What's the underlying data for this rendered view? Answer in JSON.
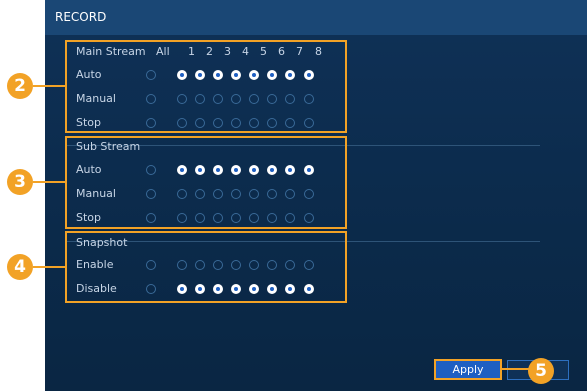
{
  "window": {
    "title": "RECORD"
  },
  "main_stream": {
    "header": "Main Stream",
    "all_label": "All",
    "channels": [
      "1",
      "2",
      "3",
      "4",
      "5",
      "6",
      "7",
      "8"
    ],
    "rows": [
      {
        "label": "Auto",
        "all": false,
        "channels": [
          true,
          true,
          true,
          true,
          true,
          true,
          true,
          true
        ]
      },
      {
        "label": "Manual",
        "all": false,
        "channels": [
          false,
          false,
          false,
          false,
          false,
          false,
          false,
          false
        ]
      },
      {
        "label": "Stop",
        "all": false,
        "channels": [
          false,
          false,
          false,
          false,
          false,
          false,
          false,
          false
        ]
      }
    ]
  },
  "sub_stream": {
    "header": "Sub Stream",
    "rows": [
      {
        "label": "Auto",
        "all": false,
        "channels": [
          true,
          true,
          true,
          true,
          true,
          true,
          true,
          true
        ]
      },
      {
        "label": "Manual",
        "all": false,
        "channels": [
          false,
          false,
          false,
          false,
          false,
          false,
          false,
          false
        ]
      },
      {
        "label": "Stop",
        "all": false,
        "channels": [
          false,
          false,
          false,
          false,
          false,
          false,
          false,
          false
        ]
      }
    ]
  },
  "snapshot": {
    "header": "Snapshot",
    "rows": [
      {
        "label": "Enable",
        "all": false,
        "channels": [
          false,
          false,
          false,
          false,
          false,
          false,
          false,
          false
        ]
      },
      {
        "label": "Disable",
        "all": false,
        "channels": [
          true,
          true,
          true,
          true,
          true,
          true,
          true,
          true
        ]
      }
    ]
  },
  "callouts": [
    "2",
    "3",
    "4",
    "5"
  ],
  "buttons": {
    "apply_label": "Apply"
  },
  "colors": {
    "panel_bg": "#0b2a4a",
    "titlebar": "#1a4775",
    "accent": "#f2a226",
    "radio_on": "#1e5fc2"
  }
}
